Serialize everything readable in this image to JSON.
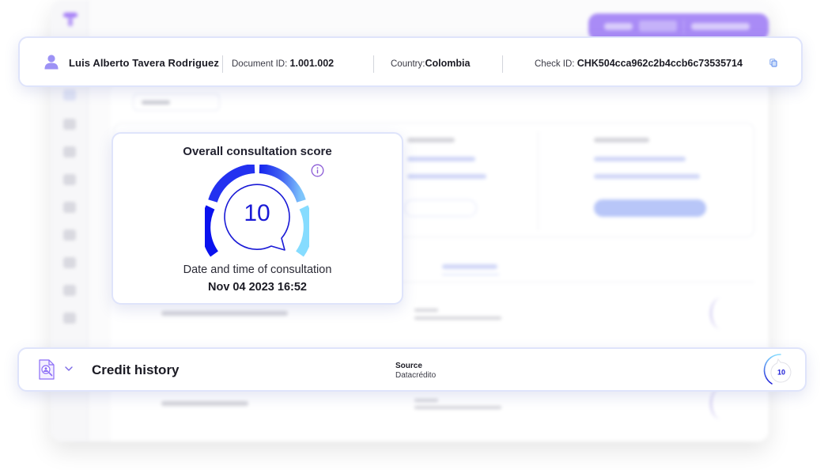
{
  "header": {
    "person_icon": "user-icon",
    "name": "Luis Alberto Tavera Rodriguez",
    "document_label": "Document ID:",
    "document_value": "1.001.002",
    "country_label": "Country:",
    "country_value": "Colombia",
    "check_label": "Check ID:",
    "check_value": "CHK504cca962c2b4ccb6c73535714",
    "copy_icon": "copy-icon"
  },
  "score_card": {
    "title": "Overall consultation score",
    "score": "10",
    "info_icon": "info-icon",
    "date_label": "Date and time of consultation",
    "date_value": "Nov 04 2023 16:52",
    "gauge_colors": [
      "#0a12f0",
      "#2a3df0",
      "#5a8cf5",
      "#86dcff"
    ]
  },
  "credit_card": {
    "icon": "document-search-icon",
    "title": "Credit history",
    "source_label": "Source",
    "source_value": "Datacrédito",
    "score": "10"
  },
  "colors": {
    "accent": "#8b6cf6",
    "card_border": "#dfe4fb",
    "gauge_ring": "#1a1ad6"
  }
}
